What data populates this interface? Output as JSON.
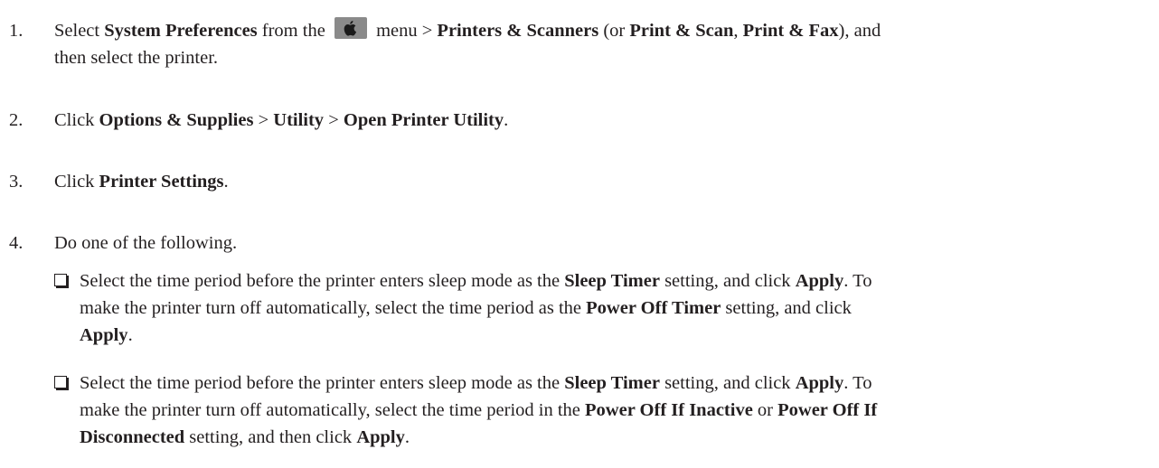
{
  "steps": [
    {
      "num": "1.",
      "p": [
        "Select ",
        "System Preferences",
        " from the ",
        " menu > ",
        "Printers & Scanners",
        " (or ",
        "Print & Scan",
        ", ",
        "Print & Fax",
        "), and",
        "then select the printer."
      ]
    },
    {
      "num": "2.",
      "p": [
        "Click ",
        "Options & Supplies",
        " > ",
        "Utility",
        " > ",
        "Open Printer Utility",
        "."
      ]
    },
    {
      "num": "3.",
      "p": [
        "Click ",
        "Printer Settings",
        "."
      ]
    },
    {
      "num": "4.",
      "p": [
        "Do one of the following."
      ]
    }
  ],
  "bullets": [
    {
      "p": [
        "Select the time period before the printer enters sleep mode as the ",
        "Sleep Timer",
        " setting, and click ",
        "Apply",
        ". To",
        "make the printer turn off automatically, select the time period as the ",
        "Power Off Timer",
        " setting, and click",
        "Apply",
        "."
      ]
    },
    {
      "p": [
        "Select the time period before the printer enters sleep mode as the ",
        "Sleep Timer",
        " setting, and click ",
        "Apply",
        ". To",
        "make the printer turn off automatically, select the time period in the ",
        "Power Off If Inactive",
        " or ",
        "Power Off If",
        "Disconnected",
        " setting, and then click ",
        "Apply",
        "."
      ]
    }
  ],
  "icons": {
    "apple_menu": "apple-icon"
  }
}
